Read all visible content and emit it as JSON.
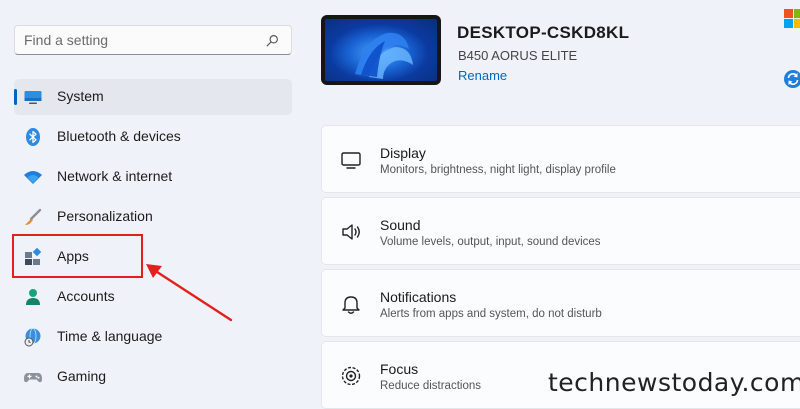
{
  "search": {
    "placeholder": "Find a setting",
    "icon": "search-icon"
  },
  "sidebar": {
    "items": [
      {
        "label": "System",
        "icon": "monitor-icon",
        "selected": true
      },
      {
        "label": "Bluetooth & devices",
        "icon": "bluetooth-icon"
      },
      {
        "label": "Network & internet",
        "icon": "wifi-icon"
      },
      {
        "label": "Personalization",
        "icon": "brush-icon"
      },
      {
        "label": "Apps",
        "icon": "apps-icon"
      },
      {
        "label": "Accounts",
        "icon": "person-icon"
      },
      {
        "label": "Time & language",
        "icon": "globe-clock-icon"
      },
      {
        "label": "Gaming",
        "icon": "gamepad-icon"
      }
    ]
  },
  "device": {
    "name": "DESKTOP-CSKD8KL",
    "model": "B450 AORUS ELITE",
    "rename_label": "Rename"
  },
  "cards": [
    {
      "title": "Display",
      "subtitle": "Monitors, brightness, night light, display profile",
      "icon": "display-icon"
    },
    {
      "title": "Sound",
      "subtitle": "Volume levels, output, input, sound devices",
      "icon": "speaker-icon"
    },
    {
      "title": "Notifications",
      "subtitle": "Alerts from apps and system, do not disturb",
      "icon": "bell-icon"
    },
    {
      "title": "Focus",
      "subtitle": "Reduce distractions",
      "icon": "focus-icon"
    }
  ],
  "watermark": "technewstoday.com",
  "colors": {
    "accent": "#0067c0",
    "highlight": "#e2201d",
    "background": "#eff3f9"
  }
}
